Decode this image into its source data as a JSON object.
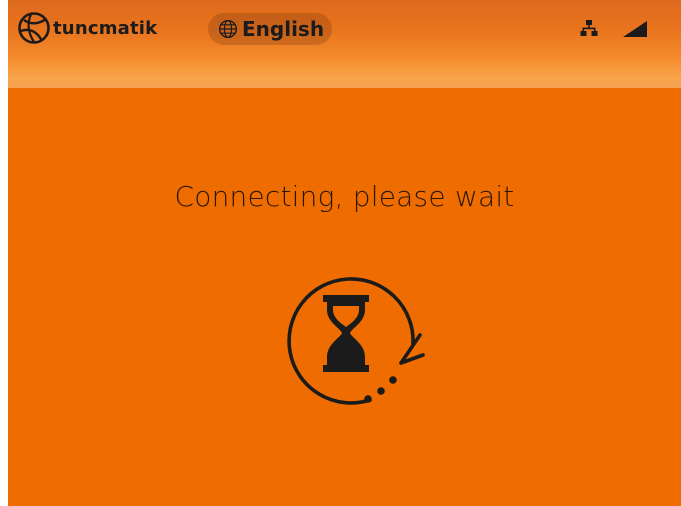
{
  "header": {
    "brand": "tuncmatik",
    "brand_icon": "tuncmatik-logo-icon",
    "language_icon": "globe-icon",
    "language_label": "English",
    "network_icon": "network-icon",
    "signal_icon": "signal-strength-icon"
  },
  "main": {
    "message": "Connecting, please wait",
    "spinner_icon": "hourglass-loading-icon"
  },
  "colors": {
    "background": "#ef6d00",
    "header_gradient_top": "#de6a1e",
    "header_gradient_bottom": "#f6a353",
    "foreground": "#1b1b1b"
  }
}
